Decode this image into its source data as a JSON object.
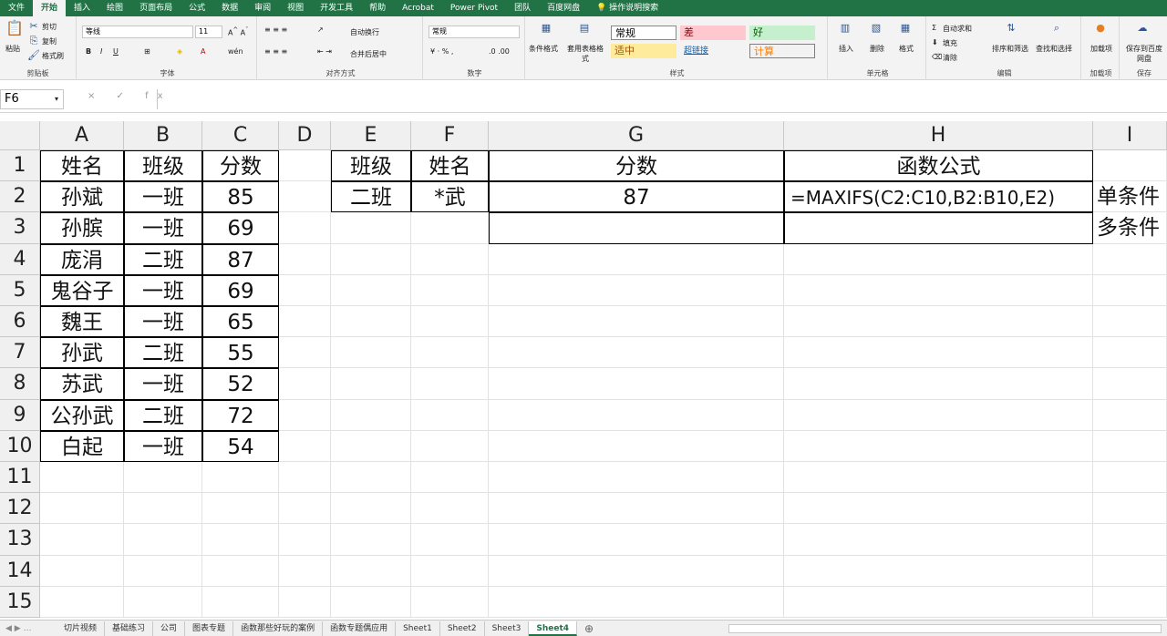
{
  "ribbon_tabs": [
    "文件",
    "开始",
    "插入",
    "绘图",
    "页面布局",
    "公式",
    "数据",
    "审阅",
    "视图",
    "开发工具",
    "帮助",
    "Acrobat",
    "Power Pivot",
    "团队",
    "百度网盘",
    "操作说明搜索"
  ],
  "clipboard": {
    "paste": "粘贴",
    "cut": "剪切",
    "copy": "复制",
    "format_painter": "格式刷",
    "label": "剪贴板"
  },
  "font": {
    "name": "等线",
    "size": "11",
    "label": "字体"
  },
  "alignment": {
    "wrap": "自动换行",
    "merge": "合并后居中",
    "label": "对齐方式"
  },
  "number": {
    "format": "常规",
    "label": "数字"
  },
  "styles": {
    "cond_format": "条件格式",
    "table_format": "套用表格格式",
    "normal": "常规",
    "bad": "差",
    "good": "好",
    "neutral": "适中",
    "hyperlink": "超链接",
    "calc": "计算",
    "label": "样式"
  },
  "cells": {
    "insert": "插入",
    "delete": "删除",
    "format": "格式",
    "label": "单元格"
  },
  "editing": {
    "autosum": "自动求和",
    "fill": "填充",
    "clear": "清除",
    "sort": "排序和筛选",
    "find": "查找和选择",
    "label": "编辑"
  },
  "addins": {
    "addin": "加载项",
    "label": "加载项"
  },
  "save": {
    "save_baidu": "保存到百度网盘",
    "label": "保存"
  },
  "formula_bar": {
    "name_box": "F6",
    "icons": "× ✓ fx",
    "formula": ""
  },
  "columns": [
    "A",
    "B",
    "C",
    "D",
    "E",
    "F",
    "G",
    "H",
    "I"
  ],
  "rows": [
    "1",
    "2",
    "3",
    "4",
    "5",
    "6",
    "7",
    "8",
    "9",
    "10",
    "11",
    "12",
    "13",
    "14",
    "15"
  ],
  "table1": [
    [
      "姓名",
      "班级",
      "分数"
    ],
    [
      "孙斌",
      "一班",
      "85"
    ],
    [
      "孙膑",
      "一班",
      "69"
    ],
    [
      "庞涓",
      "二班",
      "87"
    ],
    [
      "鬼谷子",
      "一班",
      "69"
    ],
    [
      "魏王",
      "一班",
      "65"
    ],
    [
      "孙武",
      "二班",
      "55"
    ],
    [
      "苏武",
      "一班",
      "52"
    ],
    [
      "公孙武",
      "二班",
      "72"
    ],
    [
      "白起",
      "一班",
      "54"
    ]
  ],
  "table2": {
    "headers": [
      "班级",
      "姓名",
      "分数",
      "函数公式"
    ],
    "row2": [
      "二班",
      "*武",
      "87",
      "=MAXIFS(C2:C10,B2:B10,E2)"
    ],
    "I2": "单条件",
    "I3": "多条件"
  },
  "sheets": [
    "切片视频",
    "基础练习",
    "公司",
    "图表专题",
    "函数那些好玩的案例",
    "函数专题偶应用",
    "Sheet1",
    "Sheet2",
    "Sheet3",
    "Sheet4"
  ],
  "active_sheet": "Sheet4",
  "colors": {
    "excel_green": "#217346"
  }
}
